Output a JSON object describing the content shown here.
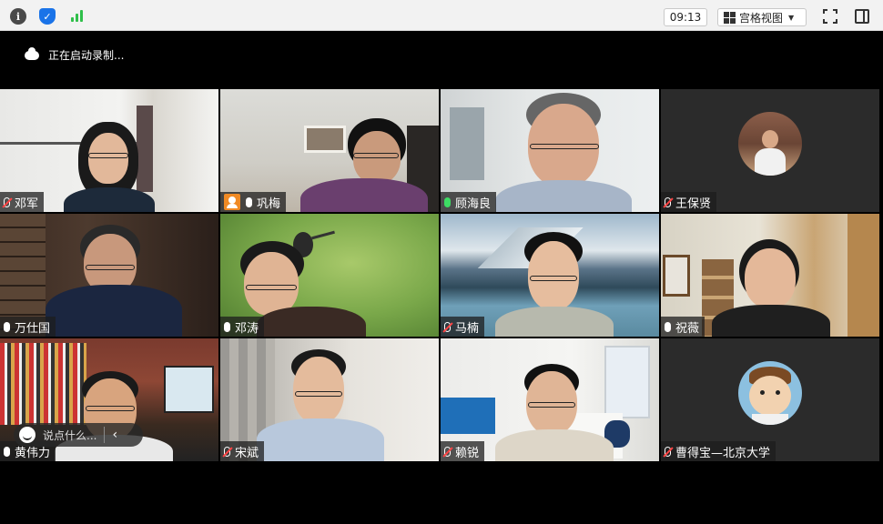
{
  "toolbar": {
    "info_icon": "info-icon",
    "shield_icon": "shield-icon",
    "signal_icon": "signal-bars-icon",
    "time": "09:13",
    "view_label": "宫格视图",
    "view_caret": "▼",
    "fullscreen_icon": "fullscreen-icon",
    "sidebar_icon": "sidebar-toggle-icon"
  },
  "recording": {
    "status": "正在启动录制..."
  },
  "participants": [
    {
      "name": "邓军",
      "mic": "muted"
    },
    {
      "name": "巩梅",
      "mic": "on"
    },
    {
      "name": "顾海良",
      "mic": "speaking"
    },
    {
      "name": "王保贤",
      "mic": "muted"
    },
    {
      "name": "万仕国",
      "mic": "on"
    },
    {
      "name": "邓涛",
      "mic": "on"
    },
    {
      "name": "马楠",
      "mic": "muted"
    },
    {
      "name": "祝薇",
      "mic": "on"
    },
    {
      "name": "黄伟力",
      "mic": "on"
    },
    {
      "name": "宋斌",
      "mic": "muted"
    },
    {
      "name": "赖锐",
      "mic": "muted"
    },
    {
      "name": "曹得宝—北京大学",
      "mic": "muted"
    }
  ],
  "chat": {
    "placeholder": "说点什么...",
    "collapse": "‹"
  },
  "colors": {
    "speaking_border": "#2ecc40",
    "muted_mic": "#ff4444",
    "accent_blue": "#1a73e8"
  }
}
